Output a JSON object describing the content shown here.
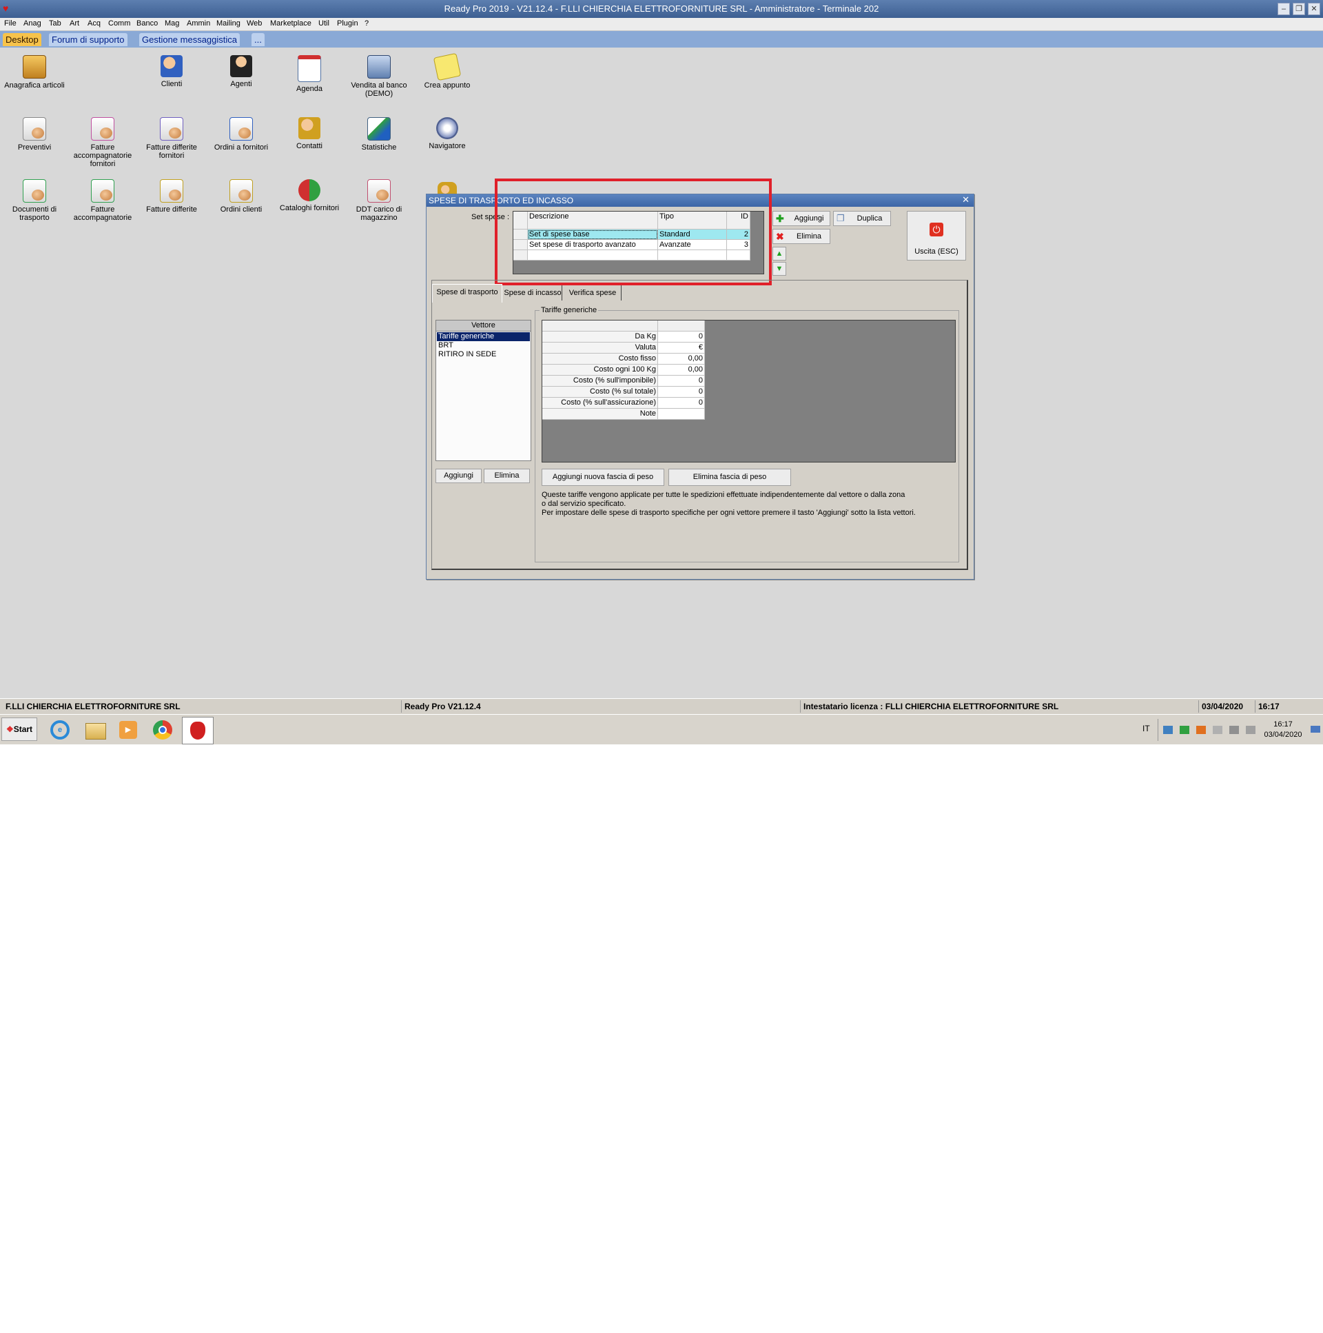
{
  "window": {
    "title": "Ready Pro 2019 - V21.12.4 - F.LLI CHIERCHIA ELETTROFORNITURE SRL - Amministratore - Terminale 202"
  },
  "menu": [
    "File",
    "Anag",
    "Tab",
    "Art",
    "Acq",
    "Comm",
    "Banco",
    "Mag",
    "Ammin",
    "Mailing",
    "Web",
    "Marketplace",
    "Util",
    "Plugin",
    "?"
  ],
  "tabs": [
    "Desktop",
    "Forum di supporto",
    "Gestione messaggistica",
    "..."
  ],
  "desktop_icons": [
    {
      "label": "Anagrafica articoli",
      "icon": "box-icon"
    },
    {
      "label": "Clienti",
      "icon": "people-icon"
    },
    {
      "label": "Agenti",
      "icon": "agent-icon"
    },
    {
      "label": "Agenda",
      "icon": "calendar-icon"
    },
    {
      "label": "Vendita al banco (DEMO)",
      "icon": "register-icon"
    },
    {
      "label": "Crea appunto",
      "icon": "note-icon"
    },
    {
      "label": "Preventivi",
      "icon": "document-icon"
    },
    {
      "label": "Fatture accompagnatorie fornitori",
      "icon": "document-icon"
    },
    {
      "label": "Fatture differite fornitori",
      "icon": "document-icon"
    },
    {
      "label": "Ordini a fornitori",
      "icon": "document-icon"
    },
    {
      "label": "Contatti",
      "icon": "contacts-icon"
    },
    {
      "label": "Statistiche",
      "icon": "chart-icon"
    },
    {
      "label": "Navigatore",
      "icon": "navigator-icon"
    },
    {
      "label": "Documenti di trasporto",
      "icon": "document-icon"
    },
    {
      "label": "Fatture accompagnatorie",
      "icon": "document-icon"
    },
    {
      "label": "Fatture differite",
      "icon": "document-icon"
    },
    {
      "label": "Ordini clienti",
      "icon": "document-icon"
    },
    {
      "label": "Cataloghi fornitori",
      "icon": "catalog-icon"
    },
    {
      "label": "DDT carico di magazzino",
      "icon": "document-icon"
    }
  ],
  "dialog": {
    "title": "SPESE DI TRASPORTO ED INCASSO",
    "set_label": "Set spese :",
    "set_columns": [
      "Descrizione",
      "Tipo",
      "ID"
    ],
    "set_rows": [
      {
        "descrizione": "Set di spese base",
        "tipo": "Standard",
        "id": "2"
      },
      {
        "descrizione": "Set spese di trasporto avanzato",
        "tipo": "Avanzate",
        "id": "3"
      }
    ],
    "buttons": {
      "aggiungi": "Aggiungi",
      "duplica": "Duplica",
      "elimina": "Elimina",
      "uscita": "Uscita (ESC)"
    },
    "inner_tabs": [
      "Spese di trasporto",
      "Spese di incasso",
      "Verifica spese"
    ],
    "vettore_header": "Vettore",
    "vettori": [
      "Tariffe generiche",
      "BRT",
      "RITIRO IN SEDE"
    ],
    "vettore_buttons": {
      "aggiungi": "Aggiungi",
      "elimina": "Elimina"
    },
    "group_title": "Tariffe generiche",
    "rate_rows": [
      {
        "label": "Da Kg",
        "value": "0"
      },
      {
        "label": "Valuta",
        "value": "€"
      },
      {
        "label": "Costo fisso",
        "value": "0,00"
      },
      {
        "label": "Costo ogni 100 Kg",
        "value": "0,00"
      },
      {
        "label": "Costo (% sull'imponibile)",
        "value": "0"
      },
      {
        "label": "Costo (% sul totale)",
        "value": "0"
      },
      {
        "label": "Costo (% sull'assicurazione)",
        "value": "0"
      },
      {
        "label": "Note",
        "value": ""
      }
    ],
    "fascia_buttons": {
      "add": "Aggiungi nuova fascia di peso",
      "delete": "Elimina fascia di peso"
    },
    "info_lines": [
      "Queste tariffe vengono applicate per tutte le spedizioni effettuate indipendentemente dal vettore o dalla zona",
      "o dal servizio specificato.",
      "Per impostare delle spese di trasporto specifiche per ogni vettore premere il tasto 'Aggiungi' sotto la lista vettori."
    ]
  },
  "status_bar": {
    "company": "F.LLI CHIERCHIA ELETTROFORNITURE SRL",
    "version": "Ready Pro V21.12.4",
    "license": "Intestatario licenza : FLLI CHIERCHIA ELETTROFORNITURE SRL",
    "date": "03/04/2020",
    "time": "16:17"
  },
  "taskbar": {
    "start": "Start",
    "lang": "IT",
    "clock_time": "16:17",
    "clock_date": "03/04/2020"
  },
  "colors": {
    "highlight_box": "#e0202a",
    "title_blue": "#3d66a6",
    "tab_active": "#f7c34b",
    "selected_row": "#9ee8f0"
  }
}
